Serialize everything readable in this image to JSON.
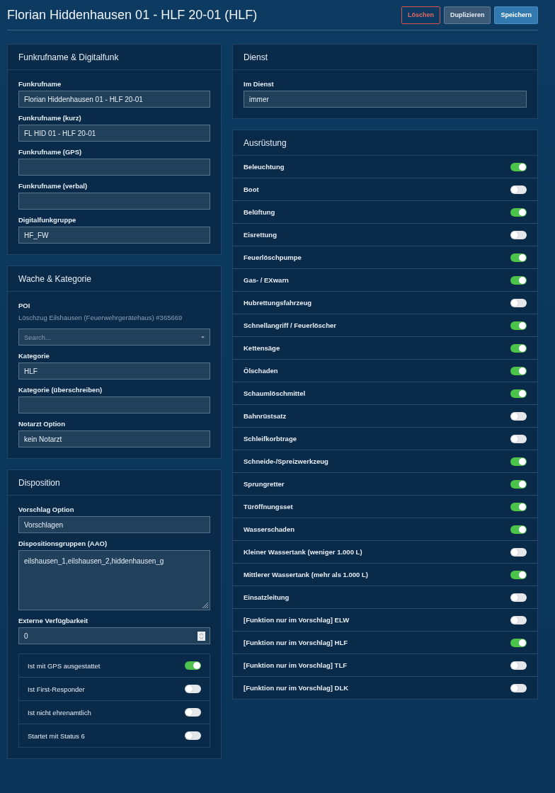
{
  "header": {
    "title": "Florian Hiddenhausen 01 - HLF 20-01 (HLF)",
    "buttons": [
      {
        "label": "Löschen",
        "kind": "danger"
      },
      {
        "label": "Duplizieren",
        "kind": "default"
      },
      {
        "label": "Speichern",
        "kind": "primary"
      }
    ]
  },
  "left_cards": [
    {
      "title": "Funkrufname & Digitalfunk",
      "fields": [
        {
          "kind": "text",
          "label": "Funkrufname",
          "value": "Florian Hiddenhausen 01 - HLF 20-01"
        },
        {
          "kind": "text",
          "label": "Funkrufname (kurz)",
          "value": "FL HID 01 - HLF 20-01"
        },
        {
          "kind": "text",
          "label": "Funkrufname (GPS)"
        },
        {
          "kind": "text",
          "label": "Funkrufname (verbal)"
        },
        {
          "kind": "text",
          "label": "Digitalfunkgruppe",
          "value": "HF_FW"
        }
      ]
    },
    {
      "title": "Wache & Kategorie",
      "fields": [
        {
          "kind": "select",
          "label": "POI",
          "note": "Löschzug Eilshausen (Feuerwehrgerätehaus) #365669",
          "placeholder": "Search..."
        },
        {
          "kind": "text",
          "label": "Kategorie",
          "value": "HLF"
        },
        {
          "kind": "text",
          "label": "Kategorie (überschreiben)"
        },
        {
          "kind": "text",
          "label": "Notarzt Option",
          "value": "kein Notarzt"
        }
      ]
    },
    {
      "title": "Disposition",
      "fields": [
        {
          "kind": "text",
          "label": "Vorschlag Option",
          "value": "Vorschlagen"
        },
        {
          "kind": "textarea",
          "label": "Dispositionsgruppen (AAO)",
          "value": "eilshausen_1,eilshausen_2,hiddenhausen_g"
        },
        {
          "kind": "number",
          "label": "Externe Verfügbarkeit",
          "value": "0"
        }
      ],
      "toggles": [
        {
          "label": "Ist mit GPS ausgestattet",
          "on": true
        },
        {
          "label": "Ist First-Responder",
          "on": false
        },
        {
          "label": "Ist nicht ehrenamtlich",
          "on": false
        },
        {
          "label": "Startet mit Status 6",
          "on": false
        }
      ]
    }
  ],
  "right_cards": [
    {
      "title": "Dienst",
      "fields": [
        {
          "kind": "text",
          "label": "Im Dienst",
          "value": "immer"
        }
      ]
    },
    {
      "title": "Ausrüstung",
      "items": [
        {
          "label": "Beleuchtung",
          "on": true
        },
        {
          "label": "Boot",
          "on": false
        },
        {
          "label": "Belüftung",
          "on": true
        },
        {
          "label": "Eisrettung",
          "on": false
        },
        {
          "label": "Feuerlöschpumpe",
          "on": true
        },
        {
          "label": "Gas- / EXwarn",
          "on": true
        },
        {
          "label": "Hubrettungsfahrzeug",
          "on": false
        },
        {
          "label": "Schnellangriff / Feuerlöscher",
          "on": true
        },
        {
          "label": "Kettensäge",
          "on": true
        },
        {
          "label": "Ölschaden",
          "on": true
        },
        {
          "label": "Schaumlöschmittel",
          "on": true
        },
        {
          "label": "Bahnrüstsatz",
          "on": false
        },
        {
          "label": "Schleifkorbtrage",
          "on": false
        },
        {
          "label": "Schneide-/Spreizwerkzeug",
          "on": true
        },
        {
          "label": "Sprungretter",
          "on": true
        },
        {
          "label": "Türöffnungsset",
          "on": true
        },
        {
          "label": "Wasserschaden",
          "on": true
        },
        {
          "label": "Kleiner Wassertank (weniger 1.000 L)",
          "on": false
        },
        {
          "label": "Mittlerer Wassertank (mehr als 1.000 L)",
          "on": true
        },
        {
          "label": "Einsatzleitung",
          "on": false
        },
        {
          "label": "[Funktion nur im Vorschlag] ELW",
          "on": false
        },
        {
          "label": "[Funktion nur im Vorschlag] HLF",
          "on": true
        },
        {
          "label": "[Funktion nur im Vorschlag] TLF",
          "on": false
        },
        {
          "label": "[Funktion nur im Vorschlag] DLK",
          "on": false
        }
      ]
    }
  ]
}
